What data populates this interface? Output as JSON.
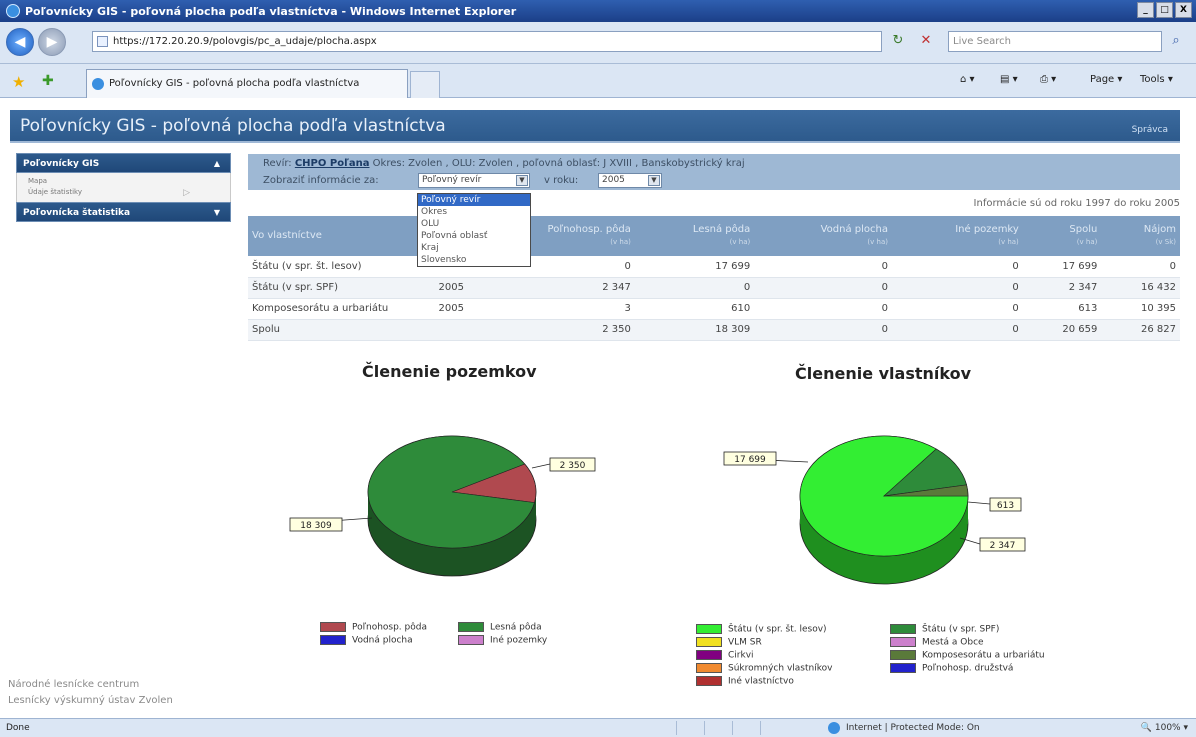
{
  "window": {
    "title": "Poľovnícky GIS - poľovná plocha podľa vlastníctva - Windows Internet Explorer",
    "minimize": "_",
    "maximize": "□",
    "close": "X"
  },
  "address": {
    "url": "https://172.20.20.9/polovgis/pc_a_udaje/plocha.aspx",
    "search_placeholder": "Live Search",
    "back": "◀",
    "forward": "▶"
  },
  "tabs": {
    "active_tab": "Poľovnícky GIS - poľovná plocha podľa vlastníctva",
    "page_cmd": "Page ▾",
    "tools_cmd": "Tools ▾"
  },
  "page": {
    "title": "Poľovnícky GIS - poľovná plocha podľa vlastníctva",
    "help_link": "Správca"
  },
  "sidebar": {
    "section1": {
      "label": "Poľovnícky GIS",
      "items": [
        "Mapa",
        "Údaje štatistiky"
      ]
    },
    "section2": {
      "label": "Poľovnícka štatistika"
    }
  },
  "footer": {
    "line1": "Národné lesnícke centrum",
    "line2": "Lesnícky výskumný ústav Zvolen"
  },
  "info": {
    "revir_prefix": "Revír:",
    "revir_name": "CHPO Poľana",
    "revir_rest": "Okres: Zvolen , OLU: Zvolen , poľovná oblasť: J XVIII , Banskobystrický kraj",
    "show_label": "Zobraziť informácie za:",
    "show_value": "Poľovný revír",
    "year_label": "v roku:",
    "year_value": "2005",
    "available_years": "Informácie sú od roku 1997 do roku 2005"
  },
  "dropdown": {
    "options": [
      "Poľovný revír",
      "Okres",
      "OLU",
      "Poľovná oblasť",
      "Kraj",
      "Slovensko"
    ],
    "selected": 0
  },
  "table": {
    "headers": [
      {
        "label": "Vo vlastníctve",
        "unit": ""
      },
      {
        "label": "",
        "unit": ""
      },
      {
        "label": "Poľnohosp. pôda",
        "unit": "(v ha)"
      },
      {
        "label": "Lesná pôda",
        "unit": "(v ha)"
      },
      {
        "label": "Vodná plocha",
        "unit": "(v ha)"
      },
      {
        "label": "Iné pozemky",
        "unit": "(v ha)"
      },
      {
        "label": "Spolu",
        "unit": "(v ha)"
      },
      {
        "label": "Nájom",
        "unit": "(v Sk)"
      }
    ],
    "rows": [
      [
        "Štátu (v spr. št. lesov)",
        "",
        "0",
        "17 699",
        "0",
        "0",
        "17 699",
        "0"
      ],
      [
        "Štátu (v spr. SPF)",
        "2005",
        "2 347",
        "0",
        "0",
        "0",
        "2 347",
        "16 432"
      ],
      [
        "Komposesorátu a urbariátu",
        "2005",
        "3",
        "610",
        "0",
        "0",
        "613",
        "10 395"
      ],
      [
        "Spolu",
        "",
        "2 350",
        "18 309",
        "0",
        "0",
        "20 659",
        "26 827"
      ]
    ]
  },
  "chart_data": [
    {
      "type": "pie",
      "title": "Členenie pozemkov",
      "labels": [
        "Poľnohosp. pôda",
        "Lesná pôda",
        "Vodná plocha",
        "Iné pozemky"
      ],
      "values": [
        2350,
        18309,
        0,
        0
      ],
      "colors": [
        "#b0494f",
        "#2e8b3a",
        "#2222cc",
        "#cc80cc"
      ],
      "data_labels": [
        "2 350",
        "18 309"
      ]
    },
    {
      "type": "pie",
      "title": "Členenie vlastníkov",
      "labels": [
        "Štátu (v spr. št. lesov)",
        "Štátu (v spr. SPF)",
        "VLM SR",
        "Mestá a Obce",
        "Cirkvi",
        "Komposesorátu a urbariátu",
        "Súkromných vlastníkov",
        "Poľnohosp. družstvá",
        "Iné vlastníctvo"
      ],
      "values": [
        17699,
        2347,
        0,
        0,
        0,
        613,
        0,
        0,
        0
      ],
      "colors": [
        "#33ee33",
        "#2e8b3a",
        "#f0e020",
        "#cc80cc",
        "#800080",
        "#5a7a3a",
        "#f08a30",
        "#2222cc",
        "#b03030"
      ],
      "data_labels": [
        "17 699",
        "613",
        "2 347"
      ]
    }
  ],
  "status": {
    "done": "Done",
    "zone": "Internet | Protected Mode: On",
    "zoom": "100%"
  }
}
